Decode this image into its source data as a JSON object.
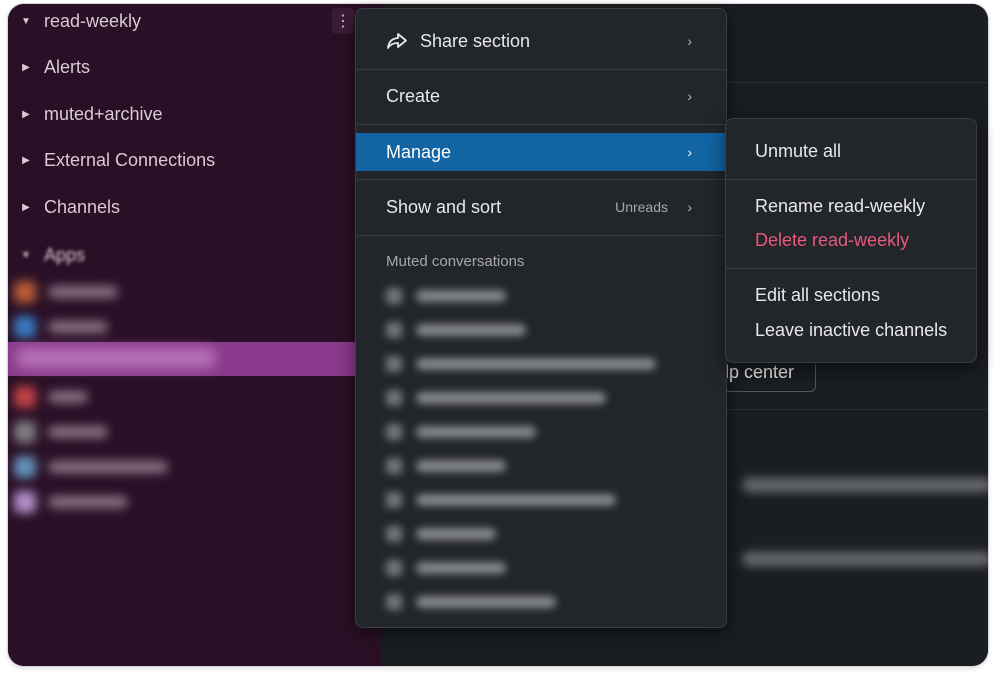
{
  "sidebar": {
    "sections": [
      {
        "label": "read-weekly",
        "expanded": true
      },
      {
        "label": "Alerts",
        "expanded": false
      },
      {
        "label": "muted+archive",
        "expanded": false
      },
      {
        "label": "External Connections",
        "expanded": false
      },
      {
        "label": "Channels",
        "expanded": false
      },
      {
        "label": "Apps",
        "expanded": true
      }
    ],
    "more_icon": "vertical-ellipsis-icon"
  },
  "menu": {
    "items": [
      {
        "label": "Share section",
        "icon": "share-arrow-icon"
      },
      {
        "label": "Create"
      },
      {
        "label": "Manage",
        "active": true
      },
      {
        "label": "Show and sort",
        "hint": "Unreads"
      }
    ],
    "muted_heading": "Muted conversations"
  },
  "submenu": {
    "items": [
      {
        "label": "Unmute all"
      },
      {
        "label": "Rename read-weekly"
      },
      {
        "label": "Delete read-weekly",
        "danger": true
      },
      {
        "label": "Edit all sections"
      },
      {
        "label": "Leave inactive channels"
      }
    ]
  },
  "main": {
    "help_button_label": "elp center"
  },
  "colors": {
    "sidebar_bg": "#2a1026",
    "selected_channel": "#8a3a8c",
    "menu_bg": "#222529",
    "active_item": "#1264a3",
    "danger_text": "#e8597e"
  }
}
